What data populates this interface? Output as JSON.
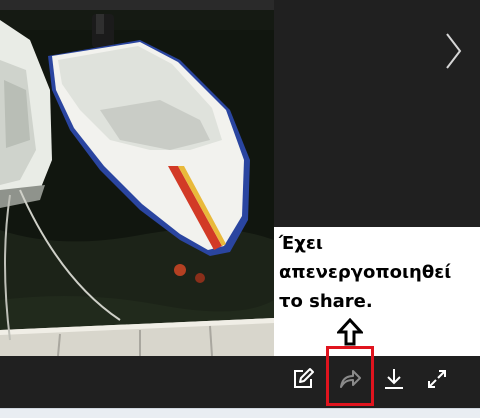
{
  "viewer": {
    "annotation": {
      "lines": [
        "Έχει",
        "απενεργοποιηθεί",
        "το share."
      ]
    },
    "icons": {
      "next": "chevron-right-icon",
      "edit": "edit-icon",
      "share": "share-icon",
      "download": "download-icon",
      "fullscreen": "fullscreen-icon",
      "pointer": "arrow-up-icon"
    },
    "colors": {
      "background": "#202020",
      "highlight": "#e0141e",
      "icon": "#ffffff",
      "share_icon_disabled": "#8a8a8a"
    }
  }
}
